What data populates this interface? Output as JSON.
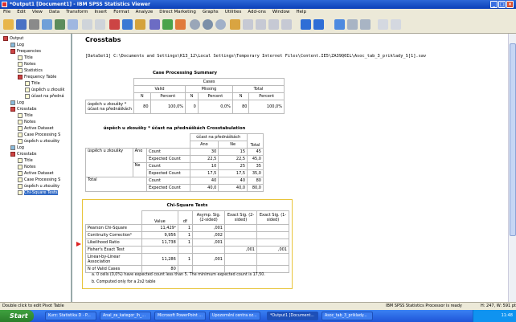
{
  "window": {
    "title": "*Output1 [Document1] - IBM SPSS Statistics Viewer"
  },
  "menu": [
    "File",
    "Edit",
    "View",
    "Data",
    "Transform",
    "Insert",
    "Format",
    "Analyze",
    "Direct Marketing",
    "Graphs",
    "Utilities",
    "Add-ons",
    "Window",
    "Help"
  ],
  "tree": {
    "items": [
      {
        "label": "Output",
        "icon": "output-icon",
        "level": 0
      },
      {
        "label": "Log",
        "icon": "log-icon",
        "level": 1
      },
      {
        "label": "Frequencies",
        "icon": "folder-icon",
        "level": 1
      },
      {
        "label": "Title",
        "icon": "title-icon",
        "level": 2
      },
      {
        "label": "Notes",
        "icon": "notes-icon",
        "level": 2
      },
      {
        "label": "Statistics",
        "icon": "table-icon",
        "level": 2
      },
      {
        "label": "Frequency Table",
        "icon": "folder-icon",
        "level": 2
      },
      {
        "label": "Title",
        "icon": "title-icon",
        "level": 3
      },
      {
        "label": "úspěch u zkoušk",
        "icon": "table-icon",
        "level": 3
      },
      {
        "label": "účast na předná",
        "icon": "table-icon",
        "level": 3
      },
      {
        "label": "Log",
        "icon": "log-icon",
        "level": 1
      },
      {
        "label": "Crosstabs",
        "icon": "folder-icon",
        "level": 1
      },
      {
        "label": "Title",
        "icon": "title-icon",
        "level": 2
      },
      {
        "label": "Notes",
        "icon": "notes-icon",
        "level": 2
      },
      {
        "label": "Active Dataset",
        "icon": "table-icon",
        "level": 2
      },
      {
        "label": "Case Processing S",
        "icon": "table-icon",
        "level": 2
      },
      {
        "label": "úspěch u zkoušky",
        "icon": "table-icon",
        "level": 2
      },
      {
        "label": "Log",
        "icon": "log-icon",
        "level": 1
      },
      {
        "label": "Crosstabs",
        "icon": "folder-icon",
        "level": 1
      },
      {
        "label": "Title",
        "icon": "title-icon",
        "level": 2
      },
      {
        "label": "Notes",
        "icon": "notes-icon",
        "level": 2
      },
      {
        "label": "Active Dataset",
        "icon": "table-icon",
        "level": 2
      },
      {
        "label": "Case Processing S",
        "icon": "table-icon",
        "level": 2
      },
      {
        "label": "úspěch u zkoušky",
        "icon": "table-icon",
        "level": 2
      },
      {
        "label": "Chi-Square Tests",
        "icon": "table-icon",
        "level": 2,
        "selected": true
      }
    ]
  },
  "content": {
    "heading": "Crosstabs",
    "dataset_line": "[DataSet1] C:\\Documents and Settings\\K13_12\\Local Settings\\Temporary Internet Files\\Content.IE5\\ZA39Q0IL\\Asoc_tab_3_priklady_S[1].sav",
    "cps": {
      "title": "Case Processing Summary",
      "cases": "Cases",
      "valid": "Valid",
      "missing": "Missing",
      "total": "Total",
      "n": "N",
      "percent": "Percent",
      "row_label": "úspěch u zkoušky * účast na přednáškách",
      "vals": [
        "80",
        "100,0%",
        "0",
        "0,0%",
        "80",
        "100,0%"
      ]
    },
    "ct": {
      "title": "úspěch u zkoušky * účast na přednáškách Crosstabulation",
      "col_var": "účast na přednáškách",
      "ano": "Ano",
      "ne": "Ne",
      "total": "Total",
      "row_var": "úspěch u zkoušky",
      "r_ano": "Ano",
      "r_ne": "Ne",
      "row_total": "Total",
      "count": "Count",
      "expected": "Expected Count",
      "rows": [
        [
          "30",
          "15",
          "45"
        ],
        [
          "22,5",
          "22,5",
          "45,0"
        ],
        [
          "10",
          "25",
          "35"
        ],
        [
          "17,5",
          "17,5",
          "35,0"
        ],
        [
          "40",
          "40",
          "80"
        ],
        [
          "40,0",
          "40,0",
          "80,0"
        ]
      ]
    },
    "chi": {
      "title": "Chi-Square Tests",
      "h_value": "Value",
      "h_df": "df",
      "h_asymp": "Asymp. Sig. (2-sided)",
      "h_exact2": "Exact Sig. (2-sided)",
      "h_exact1": "Exact Sig. (1-sided)",
      "rows": [
        {
          "label": "Pearson Chi-Square",
          "value": "11,429ᵃ",
          "df": "1",
          "asymp": ",001",
          "e2": "",
          "e1": ""
        },
        {
          "label": "Continuity Correctionᵇ",
          "value": "9,956",
          "df": "1",
          "asymp": ",002",
          "e2": "",
          "e1": ""
        },
        {
          "label": "Likelihood Ratio",
          "value": "11,738",
          "df": "1",
          "asymp": ",001",
          "e2": "",
          "e1": ""
        },
        {
          "label": "Fisher's Exact Test",
          "value": "",
          "df": "",
          "asymp": "",
          "e2": ",001",
          "e1": ",001"
        },
        {
          "label": "Linear-by-Linear Association",
          "value": "11,286",
          "df": "1",
          "asymp": ",001",
          "e2": "",
          "e1": ""
        },
        {
          "label": "N of Valid Cases",
          "value": "80",
          "df": "",
          "asymp": "",
          "e2": "",
          "e1": ""
        }
      ],
      "fn_a": "a. 0 cells (0,0%) have expected count less than 5. The minimum expected count is 17,50.",
      "fn_b": "b. Computed only for a 2x2 table"
    }
  },
  "status": {
    "left": "Double click to edit Pivot Table",
    "processor": "IBM SPSS Statistics Processor is ready",
    "coords": "H: 247, W: 591 pt"
  },
  "taskbar": {
    "start": "Start",
    "tasks": [
      "Kurz: Statistika D - P...",
      "Anal_za_kategor_lh_...",
      "Microsoft PowerPoint ...",
      "Upozornění centra oz...",
      "*Output1 [Document...",
      "Asoc_tab_3_priklady..."
    ],
    "clock": "11:48"
  }
}
